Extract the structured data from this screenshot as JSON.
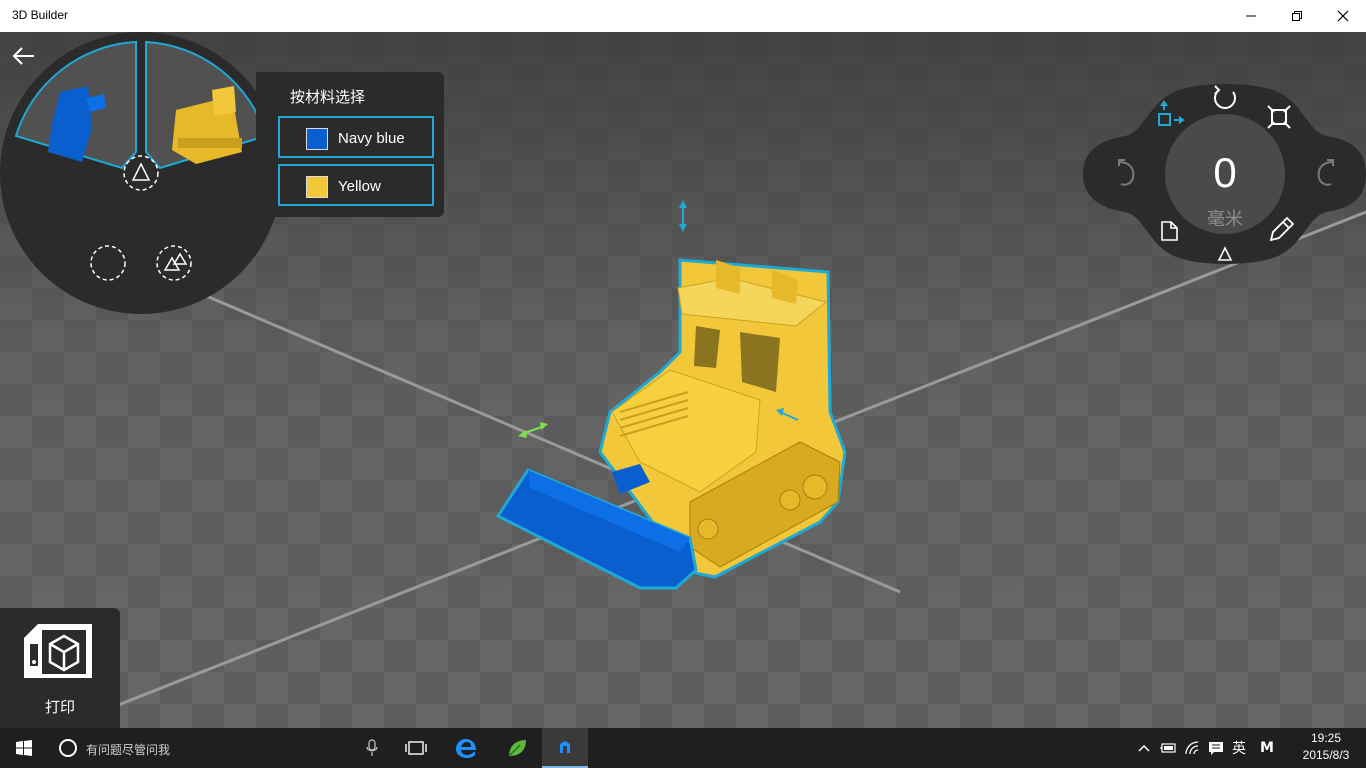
{
  "window": {
    "title": "3D Builder",
    "controls": [
      "minimize-icon",
      "restore-icon",
      "close-icon"
    ]
  },
  "material_picker": {
    "title": "按材料选择",
    "materials": [
      {
        "name": "Navy blue",
        "color": "#0a5fcf"
      },
      {
        "name": "Yellow",
        "color": "#f2c739"
      }
    ],
    "accent": "#1fa9d6"
  },
  "transform_hub": {
    "value": "0",
    "unit": "毫米",
    "icons": [
      "move-icon",
      "rotate-icon",
      "scale-icon",
      "undo-icon",
      "redo-icon",
      "document-icon",
      "triangle-icon",
      "pencil-icon"
    ]
  },
  "print": {
    "label": "打印"
  },
  "taskbar": {
    "search_placeholder": "有问题尽管问我",
    "tray_lang": "英",
    "tray_ime": "M",
    "time": "19:25",
    "date": "2015/8/3"
  },
  "colors": {
    "titlebar": "#ffffff",
    "panel": "#2b2b2b",
    "taskbar": "#1f1f1f",
    "accent": "#1fa9d6",
    "model_yellow": "#f2c739",
    "model_blue": "#0a5fcf"
  }
}
